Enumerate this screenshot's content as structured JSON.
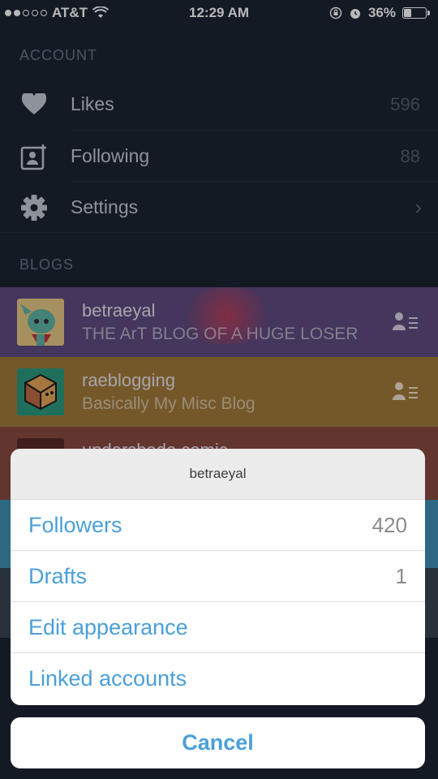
{
  "status_bar": {
    "carrier": "AT&T",
    "time": "12:29 AM",
    "battery": "36%",
    "battery_level": 0.36
  },
  "account": {
    "heading": "ACCOUNT",
    "items": [
      {
        "label": "Likes",
        "value": "596",
        "icon": "heart-icon"
      },
      {
        "label": "Following",
        "value": "88",
        "icon": "add-person-icon"
      },
      {
        "label": "Settings",
        "icon": "gear-icon"
      }
    ]
  },
  "blogs": {
    "heading": "BLOGS",
    "items": [
      {
        "name": "betraeyal",
        "description": "THE ArT BLOG OF A HUGE LOSER",
        "color": "#5f4b82"
      },
      {
        "name": "raeblogging",
        "description": "Basically My Misc Blog",
        "color": "#a27a3a"
      },
      {
        "name": "undershade comic",
        "color": "#8a4a42"
      }
    ]
  },
  "sheet": {
    "title": "betraeyal",
    "items": [
      {
        "label": "Followers",
        "count": "420"
      },
      {
        "label": "Drafts",
        "count": "1"
      },
      {
        "label": "Edit appearance",
        "count": ""
      },
      {
        "label": "Linked accounts",
        "count": ""
      }
    ],
    "cancel": "Cancel"
  },
  "colors": {
    "accent": "#4b9fd9",
    "background": "#1b2533"
  }
}
